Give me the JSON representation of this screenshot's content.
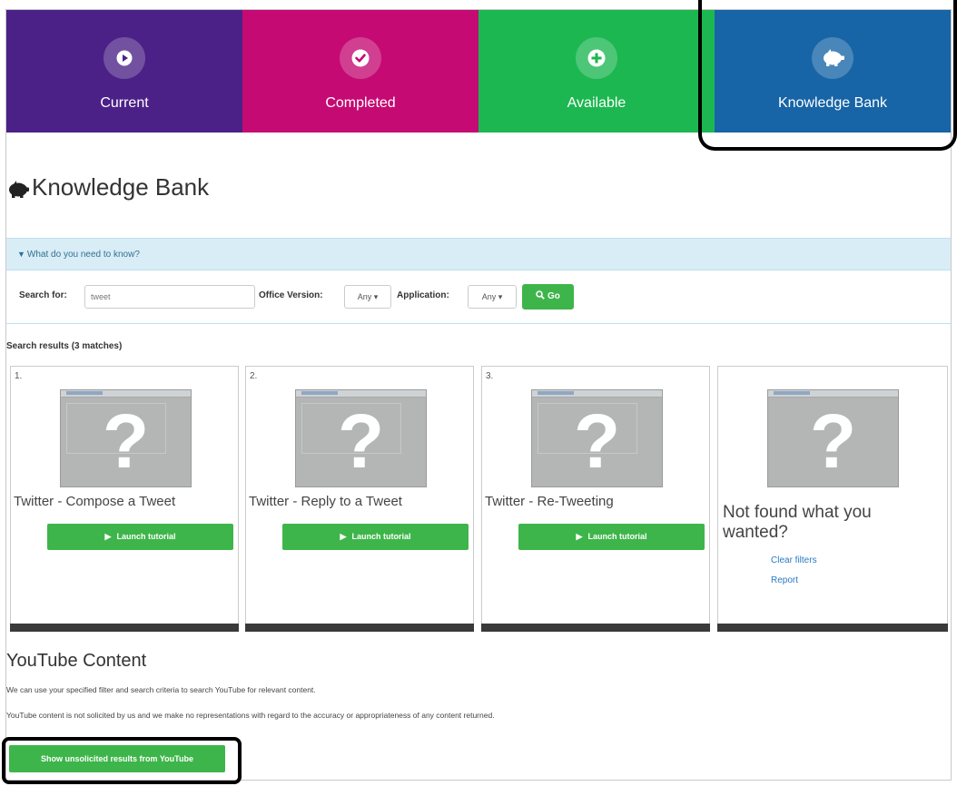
{
  "tabs": [
    {
      "label": "Current",
      "icon": "play-icon",
      "color": "#4b2187"
    },
    {
      "label": "Completed",
      "icon": "check-icon",
      "color": "#c50a73"
    },
    {
      "label": "Available",
      "icon": "plus-icon",
      "color": "#1cb751"
    },
    {
      "label": "Knowledge Bank",
      "icon": "piggy-bank-icon",
      "color": "#1764a6"
    }
  ],
  "page": {
    "title": "Knowledge Bank",
    "title_icon": "piggy-bank-icon"
  },
  "panel": {
    "header": "What do you need to know?"
  },
  "search": {
    "search_for_label": "Search for:",
    "query_value": "tweet",
    "office_version_label": "Office Version:",
    "office_version_value": "Any",
    "application_label": "Application:",
    "application_value": "Any",
    "go_label": "Go",
    "go_icon": "search-icon"
  },
  "results": {
    "label": "Search results (3 matches)",
    "items": [
      {
        "number": "1.",
        "title": "Twitter - Compose a Tweet",
        "button": "Launch tutorial"
      },
      {
        "number": "2.",
        "title": "Twitter - Reply to a Tweet",
        "button": "Launch tutorial"
      },
      {
        "number": "3.",
        "title": "Twitter - Re-Tweeting",
        "button": "Launch tutorial"
      }
    ],
    "not_found": {
      "title": "Not found what you wanted?",
      "links": [
        "Clear filters",
        "Report"
      ]
    }
  },
  "youtube": {
    "title": "YouTube Content",
    "line1": "We can use your specified filter and search criteria to search YouTube for relevant content.",
    "line2": "YouTube content is not solicited by us and we make no representations with regard to the accuracy or appropriateness of any content returned.",
    "button": "Show unsolicited results from YouTube"
  },
  "colors": {
    "accent_green": "#3eb54a",
    "panel_blue": "#d9edf7",
    "link": "#2a7bc0",
    "highlight": "#000000"
  }
}
